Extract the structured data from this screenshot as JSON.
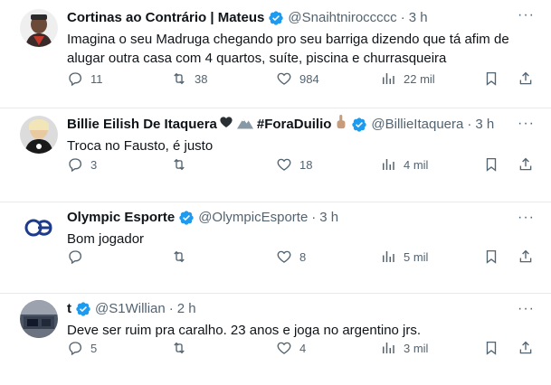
{
  "tweets": [
    {
      "name": "Cortinas ao Contrário | Mateus",
      "handle": "@Snaihtniroccccc",
      "time": "3 h",
      "text": "Imagina o seu Madruga chegando pro seu barriga dizendo que tá afim de alugar outra casa com 4 quartos, suíte, piscina e churrasqueira",
      "replies": "11",
      "retweets": "38",
      "likes": "984",
      "views": "22 mil"
    },
    {
      "name": "Billie Eilish De Itaquera",
      "name_extra": "#ForaDuilio",
      "handle": "@BillieItaquera",
      "time": "3 h",
      "text": "Troca no Fausto, é justo",
      "replies": "3",
      "retweets": "",
      "likes": "18",
      "views": "4 mil"
    },
    {
      "name": "Olympic Esporte",
      "handle": "@OlympicEsporte",
      "time": "3 h",
      "text": "Bom jogador",
      "replies": "",
      "retweets": "",
      "likes": "8",
      "views": "5 mil"
    },
    {
      "name": "t",
      "handle": "@S1Willian",
      "time": "2 h",
      "text": "Deve ser ruim pra caralho. 23 anos e joga no argentino jrs.",
      "replies": "5",
      "retweets": "",
      "likes": "4",
      "views": "3 mil"
    }
  ],
  "colors": {
    "verified": "#1d9bf0",
    "muted": "#536471",
    "divider": "#e7e9ea"
  },
  "icons": [
    "more-icon",
    "reply-icon",
    "retweet-icon",
    "like-icon",
    "views-icon",
    "bookmark-icon",
    "share-icon",
    "verified-icon",
    "heart-emoji",
    "mountain-emoji",
    "hand-emoji"
  ],
  "dot": "·",
  "more": "···"
}
